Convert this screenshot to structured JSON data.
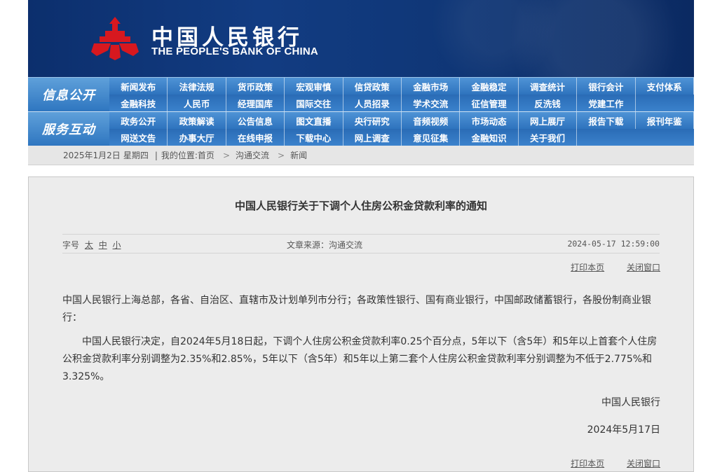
{
  "header": {
    "bank_name_cn": "中国人民银行",
    "bank_name_en": "THE PEOPLE'S BANK OF CHINA",
    "emblem_icon": "pboc-emblem-icon",
    "colors": {
      "banner": "#123c82",
      "emblem": "#d7181f",
      "nav": "#3b82cc"
    }
  },
  "nav": {
    "groups": [
      {
        "label": "信息公开",
        "items": [
          "新闻发布",
          "法律法规",
          "货币政策",
          "宏观审慎",
          "信贷政策",
          "金融市场",
          "金融稳定",
          "调查统计",
          "银行会计",
          "支付体系",
          "金融科技",
          "人民币",
          "经理国库",
          "国际交往",
          "人员招录",
          "学术交流",
          "征信管理",
          "反洗钱",
          "党建工作"
        ]
      },
      {
        "label": "服务互动",
        "items": [
          "政务公开",
          "政策解读",
          "公告信息",
          "图文直播",
          "央行研究",
          "音频视频",
          "市场动态",
          "网上展厅",
          "报告下载",
          "报刊年鉴",
          "网送文告",
          "办事大厅",
          "在线申报",
          "下载中心",
          "网上调查",
          "意见征集",
          "金融知识",
          "关于我们"
        ]
      }
    ]
  },
  "breadcrumb": {
    "date": "2025年1月2日",
    "weekday": "星期四",
    "divider": "|",
    "location_label": "我的位置:",
    "items": [
      "首页",
      "沟通交流",
      "新闻"
    ],
    "separator": ">"
  },
  "article": {
    "title": "中国人民银行关于下调个人住房公积金贷款利率的通知",
    "font_size_label": "字号",
    "font_sizes": [
      "太",
      "中",
      "小"
    ],
    "source": "文章来源：沟通交流",
    "publish_time": "2024-05-17 12:59:00",
    "print_label": "打印本页",
    "close_label": "关闭窗口",
    "paragraph1": "中国人民银行上海总部，各省、自治区、直辖市及计划单列市分行；各政策性银行、国有商业银行，中国邮政储蓄银行，各股份制商业银行：",
    "paragraph2": "中国人民银行决定，自2024年5月18日起，下调个人住房公积金贷款利率0.25个百分点，5年以下（含5年）和5年以上首套个人住房公积金贷款利率分别调整为2.35%和2.85%，5年以下（含5年）和5年以上第二套个人住房公积金贷款利率分别调整为不低于2.775%和3.325%。",
    "signature": "中国人民银行",
    "sign_date": "2024年5月17日"
  }
}
